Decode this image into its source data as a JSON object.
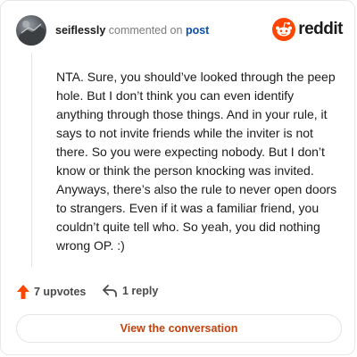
{
  "header": {
    "username": "seiflessly",
    "action_text": "commented on",
    "post_link": "post",
    "brand": "reddit",
    "avatar_icon": "user-avatar",
    "brand_icon": "reddit-snoo-icon",
    "brand_color": "#ff4500"
  },
  "comment": {
    "body": "NTA. Sure, you should’ve looked through the peep hole. But I don’t think you can even identify anything through those things. And in your rule, it says to not invite friends while the inviter is not there. So you were expecting nobody. But I don’t know or think the person knocking was invited. Anyways, there’s also the rule to never open doors to strangers. Even if it was a familiar friend, you couldn’t quite tell who. So yeah, you did nothing wrong OP. :)"
  },
  "actions": {
    "upvotes_label": "7 upvotes",
    "upvote_icon": "upvote-arrow-icon",
    "upvote_color": "#ff4500",
    "reply_label": "1 reply",
    "reply_icon": "reply-arrow-icon"
  },
  "footer": {
    "view_button_label": "View the conversation",
    "view_button_color": "#c2410c"
  }
}
